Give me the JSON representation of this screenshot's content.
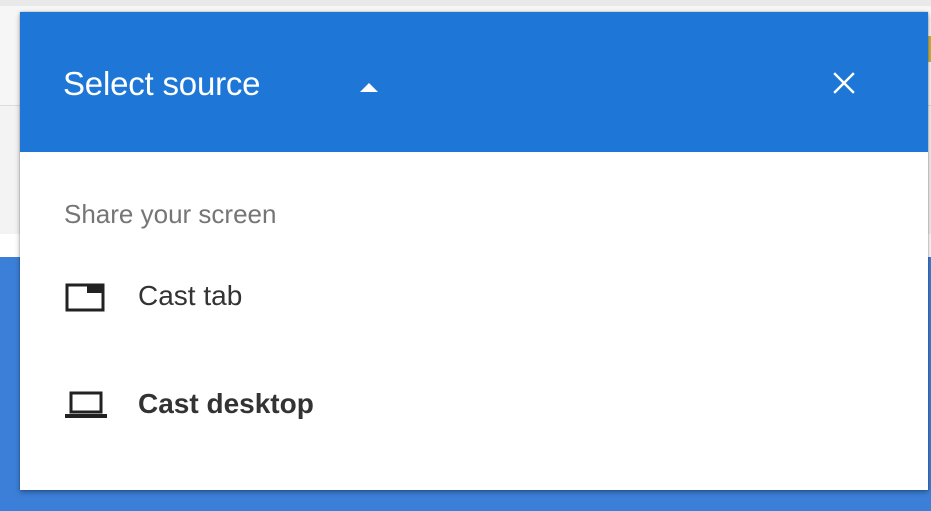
{
  "header": {
    "title": "Select source",
    "background_color": "#1e77d6",
    "dropdown_icon": "caret-up-icon",
    "close_icon": "close-icon"
  },
  "share_section": {
    "label": "Share your screen",
    "items": [
      {
        "label": "Cast tab",
        "icon": "browser-tab-icon",
        "selected": false
      },
      {
        "label": "Cast desktop",
        "icon": "laptop-icon",
        "selected": true
      }
    ]
  },
  "colors": {
    "accent": "#1e77d6",
    "background_blue": "#3b7fd8",
    "label_gray": "#757575",
    "item_text": "#333333"
  }
}
